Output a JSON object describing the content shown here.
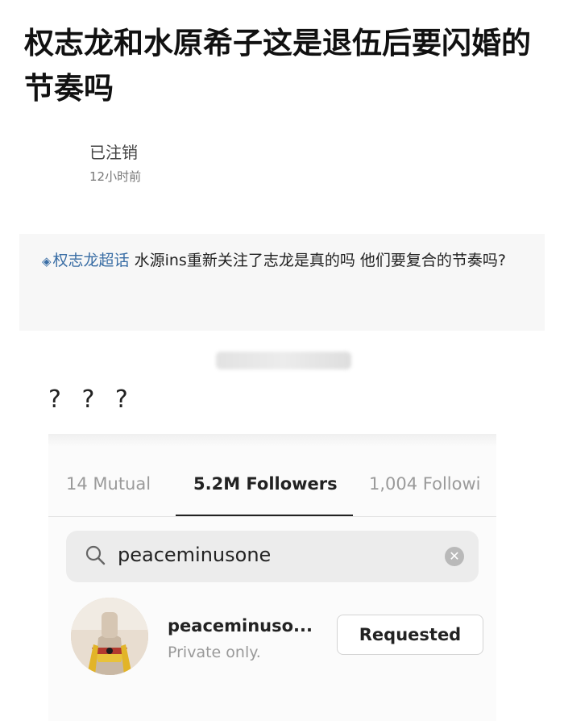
{
  "post": {
    "title": "权志龙和水原希子这是退伍后要闪婚的节奏吗",
    "author": "已注销",
    "time": "12小时前",
    "topic": "权志龙超话",
    "body": " 水源ins重新关注了志龙是真的吗 他们要复合的节奏吗?",
    "question_marks": "? ? ?"
  },
  "instagram": {
    "tabs": [
      {
        "label": "14 Mutual",
        "active": false
      },
      {
        "label": "5.2M Followers",
        "active": true
      },
      {
        "label": "1,004 Followi",
        "active": false
      }
    ],
    "search": {
      "value": "peaceminusone",
      "icon": "search-icon",
      "clear_icon": "clear-icon"
    },
    "result": {
      "username": "peaceminuso...",
      "subtitle": "Private only.",
      "button_label": "Requested"
    }
  }
}
